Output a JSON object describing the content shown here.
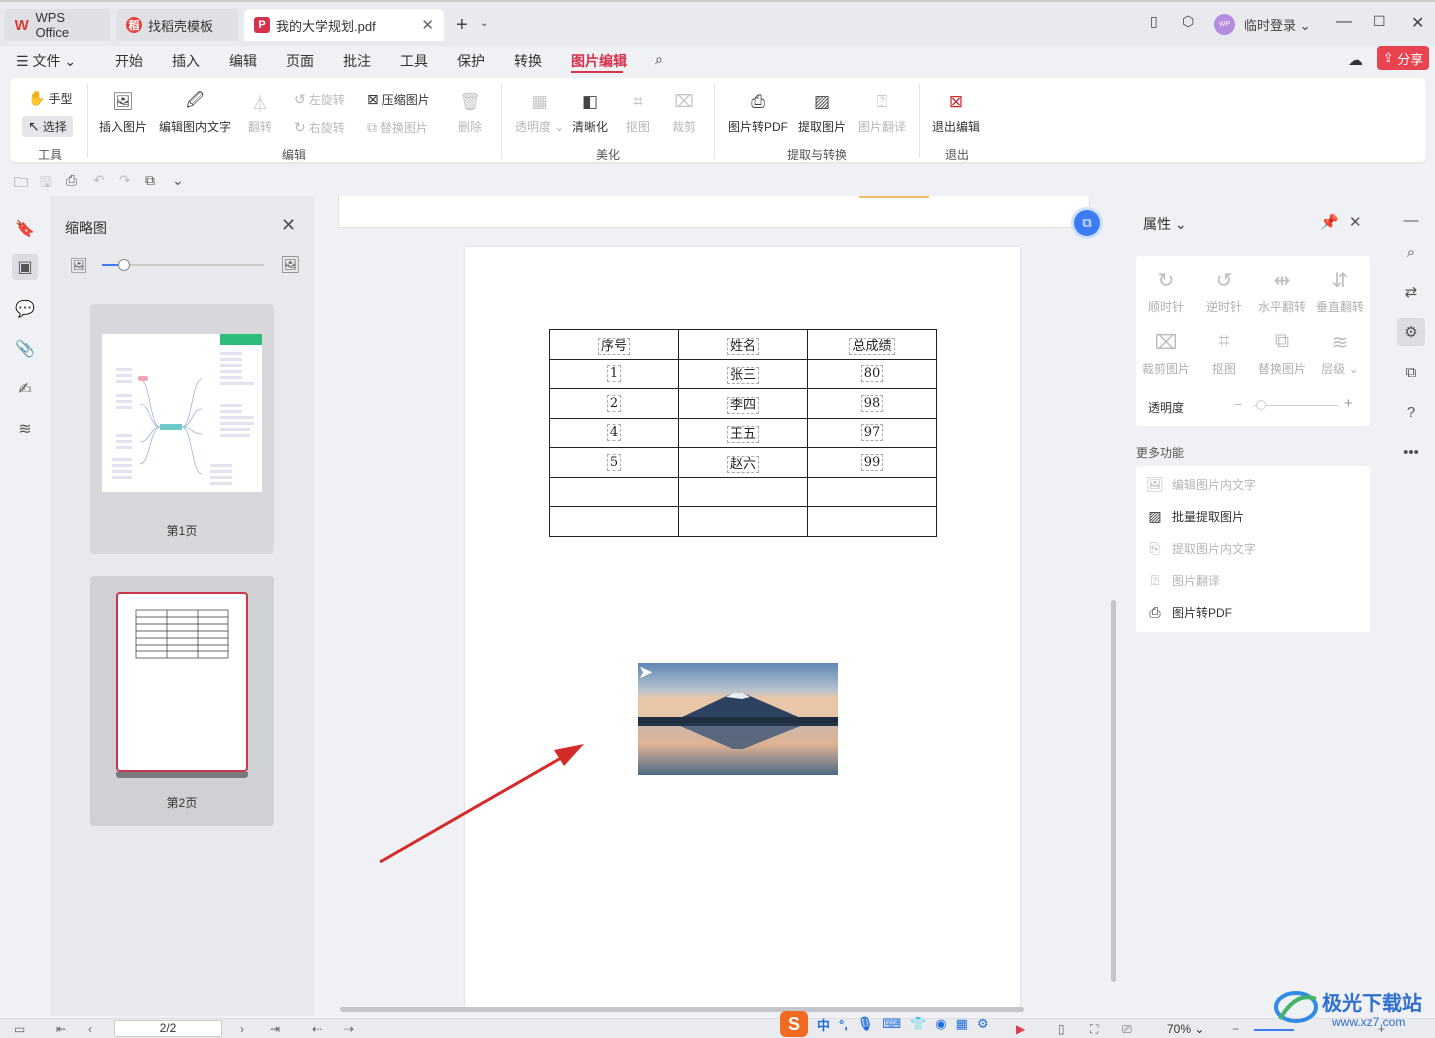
{
  "tabs": [
    {
      "label": "WPS Office",
      "icon": "wps-logo-icon"
    },
    {
      "label": "找稻壳模板",
      "icon": "daoke-icon"
    },
    {
      "label": "我的大学规划.pdf",
      "icon": "pdf-icon"
    }
  ],
  "titlebar": {
    "login_label": "临时登录"
  },
  "menu": {
    "file": "文件",
    "items": [
      "开始",
      "插入",
      "编辑",
      "页面",
      "批注",
      "工具",
      "保护",
      "转换",
      "图片编辑"
    ],
    "active": "图片编辑",
    "share": "分享"
  },
  "ribbon": {
    "tools": {
      "hand": "手型",
      "select": "选择",
      "group": "工具"
    },
    "edit": {
      "insert_image": "插入图片",
      "edit_text": "编辑图内文字",
      "flip": "翻转",
      "rotate_left": "左旋转",
      "rotate_right": "右旋转",
      "compress": "压缩图片",
      "replace": "替换图片",
      "delete": "删除",
      "group": "编辑"
    },
    "beautify": {
      "opacity": "透明度",
      "sharpen": "清晰化",
      "cutout": "抠图",
      "crop": "裁剪",
      "group": "美化"
    },
    "extract": {
      "to_pdf": "图片转PDF",
      "extract": "提取图片",
      "translate": "图片翻译",
      "group": "提取与转换"
    },
    "exit": {
      "label": "退出编辑",
      "group": "退出"
    }
  },
  "thumbnails": {
    "title": "缩略图",
    "pages": [
      {
        "label": "第1页"
      },
      {
        "label": "第2页"
      }
    ]
  },
  "table": {
    "headers": [
      "序号",
      "姓名",
      "总成绩"
    ],
    "rows": [
      [
        "1",
        "张三",
        "80"
      ],
      [
        "2",
        "李四",
        "98"
      ],
      [
        "4",
        "王五",
        "97"
      ],
      [
        "5",
        "赵六",
        "99"
      ],
      [
        "",
        "",
        ""
      ],
      [
        "",
        "",
        ""
      ]
    ]
  },
  "properties": {
    "title": "属性",
    "buttons": [
      "顺时针",
      "逆时针",
      "水平翻转",
      "垂直翻转",
      "裁剪图片",
      "抠图",
      "替换图片",
      "层级"
    ],
    "opacity_label": "透明度",
    "more_title": "更多功能",
    "more_items": [
      {
        "label": "编辑图片内文字",
        "enabled": false
      },
      {
        "label": "批量提取图片",
        "enabled": true
      },
      {
        "label": "提取图片内文字",
        "enabled": false
      },
      {
        "label": "图片翻译",
        "enabled": false
      },
      {
        "label": "图片转PDF",
        "enabled": true
      }
    ]
  },
  "statusbar": {
    "page": "2/2",
    "zoom": "70%"
  },
  "ime": {
    "mode": "中"
  },
  "watermark": {
    "title": "极光下载站",
    "url": "www.xz7.com"
  },
  "colors": {
    "accent": "#d7324b",
    "share": "#e8434f",
    "arrow": "#d42a2a",
    "primary": "#3b7cf4"
  }
}
